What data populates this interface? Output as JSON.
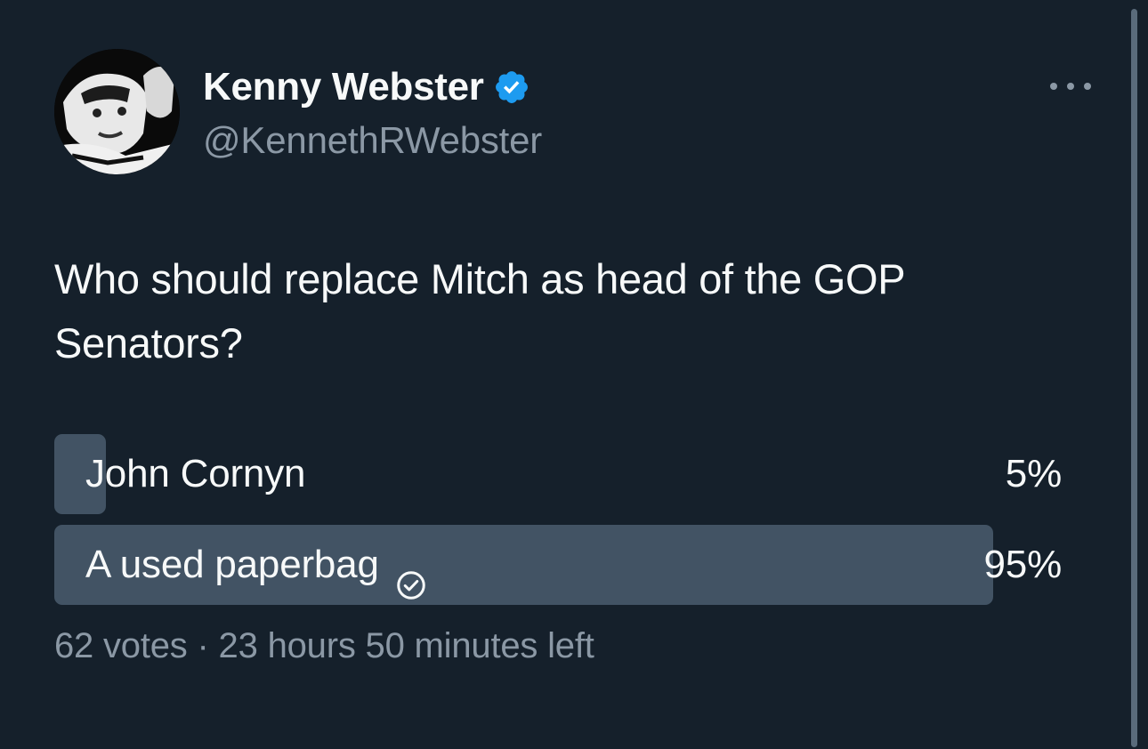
{
  "author": {
    "display_name": "Kenny Webster",
    "handle": "@KennethRWebster",
    "verified": true,
    "avatar_icon": "profile-photo"
  },
  "tweet": {
    "text": "Who should replace Mitch as head of the GOP Senators?"
  },
  "poll": {
    "options": [
      {
        "label": "John Cornyn",
        "percent_text": "5%",
        "fraction": 0.05,
        "selected": false
      },
      {
        "label": "A used paperbag",
        "percent_text": "95%",
        "fraction": 0.95,
        "selected": true
      }
    ],
    "meta": "62 votes · 23 hours 50 minutes left"
  },
  "colors": {
    "background": "#15202b",
    "bar": "#425364",
    "verified_blue": "#1d9bf0",
    "muted_text": "#8b98a5",
    "primary_text": "#f7f9f9"
  },
  "icons": {
    "verified": "verified-badge-icon",
    "more": "more-horizontal-icon",
    "selected_choice": "check-circle-icon"
  }
}
